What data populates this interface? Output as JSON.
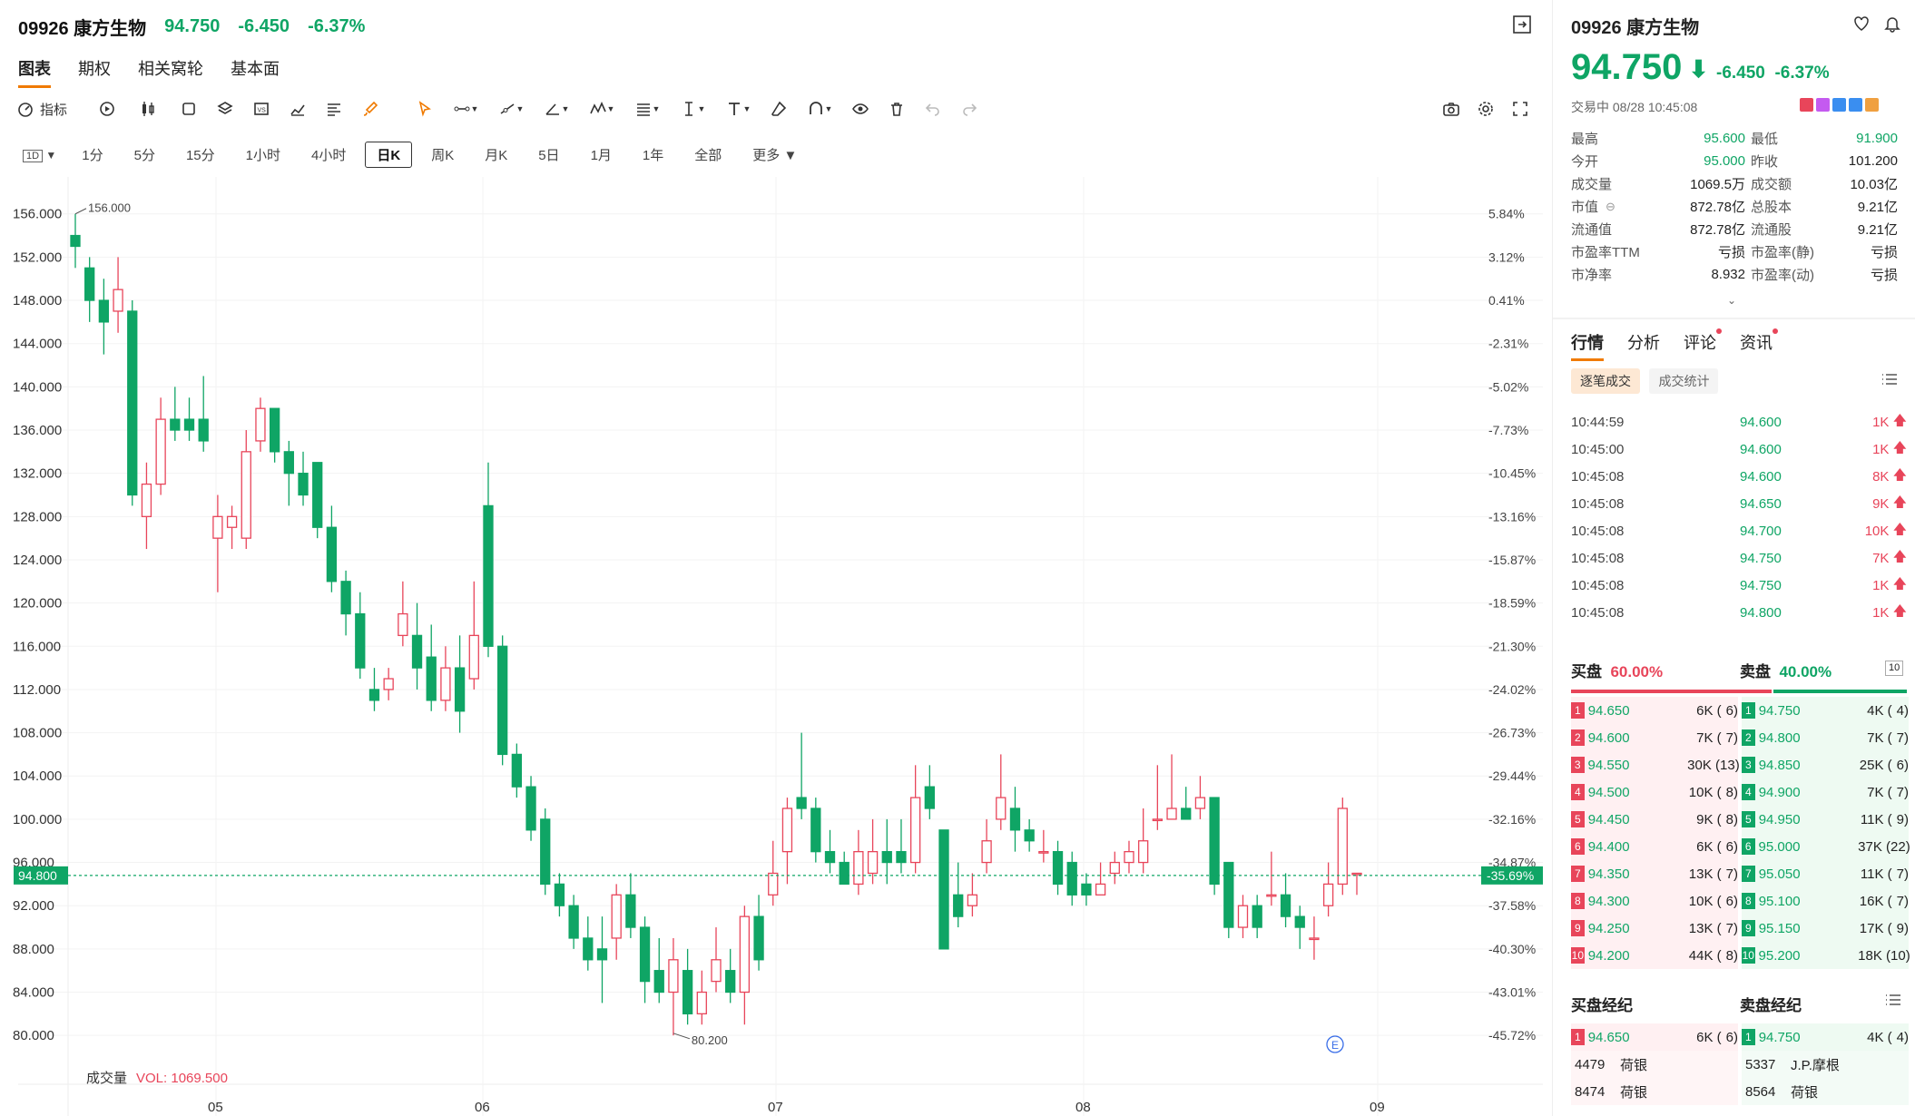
{
  "header": {
    "code": "09926 康方生物",
    "price": "94.750",
    "change": "-6.450",
    "pct": "-6.37%"
  },
  "tabs": [
    "图表",
    "期权",
    "相关窝轮",
    "基本面"
  ],
  "toolbar": {
    "indicator": "指标"
  },
  "intervals": [
    "1分",
    "5分",
    "15分",
    "1小时",
    "4小时",
    "日K",
    "周K",
    "月K",
    "5日",
    "1月",
    "1年",
    "全部",
    "更多"
  ],
  "interval_selector": "1D",
  "chart_data": {
    "type": "candlestick",
    "y_ticks": [
      "156.000",
      "152.000",
      "148.000",
      "144.000",
      "140.000",
      "136.000",
      "132.000",
      "128.000",
      "124.000",
      "120.000",
      "116.000",
      "112.000",
      "108.000",
      "104.000",
      "100.000",
      "96.000",
      "92.000",
      "88.000",
      "84.000",
      "80.000"
    ],
    "y_right_ticks": [
      "5.84%",
      "3.12%",
      "0.41%",
      "-2.31%",
      "-5.02%",
      "-7.73%",
      "-10.45%",
      "-13.16%",
      "-15.87%",
      "-18.59%",
      "-21.30%",
      "-24.02%",
      "-26.73%",
      "-29.44%",
      "-32.16%",
      "-34.87%",
      "-37.58%",
      "-40.30%",
      "-43.01%",
      "-45.72%"
    ],
    "x_ticks": [
      "05",
      "06",
      "07",
      "08",
      "09"
    ],
    "ylim": [
      78,
      159
    ],
    "high_label": "156.000",
    "low_label": "80.200",
    "last_price": "94.800",
    "last_pct": "-35.69%",
    "volume_label": "成交量",
    "volume_value": "VOL: 1069.500",
    "marker": "E",
    "candles": [
      [
        154,
        153,
        156,
        151
      ],
      [
        151,
        148,
        152,
        146
      ],
      [
        148,
        146,
        150,
        143
      ],
      [
        147,
        149,
        152,
        145
      ],
      [
        147,
        130,
        148,
        129
      ],
      [
        128,
        131,
        133,
        125
      ],
      [
        131,
        137,
        139,
        130
      ],
      [
        137,
        136,
        140,
        135
      ],
      [
        137,
        136,
        139,
        135
      ],
      [
        137,
        135,
        141,
        134
      ],
      [
        126,
        128,
        130,
        121
      ],
      [
        127,
        128,
        129,
        125
      ],
      [
        126,
        134,
        136,
        125
      ],
      [
        135,
        138,
        139,
        134
      ],
      [
        138,
        134,
        138,
        133
      ],
      [
        134,
        132,
        135,
        129
      ],
      [
        132,
        130,
        134,
        129
      ],
      [
        133,
        127,
        133,
        126
      ],
      [
        127,
        122,
        129,
        121
      ],
      [
        122,
        119,
        123,
        117
      ],
      [
        119,
        114,
        121,
        113
      ],
      [
        112,
        111,
        114,
        110
      ],
      [
        112,
        113,
        114,
        111
      ],
      [
        117,
        119,
        122,
        116
      ],
      [
        117,
        114,
        120,
        112
      ],
      [
        115,
        111,
        118,
        110
      ],
      [
        111,
        114,
        116,
        110
      ],
      [
        114,
        110,
        117,
        108
      ],
      [
        113,
        117,
        122,
        112
      ],
      [
        129,
        116,
        133,
        115
      ],
      [
        116,
        106,
        117,
        105
      ],
      [
        106,
        103,
        107,
        102
      ],
      [
        103,
        99,
        104,
        98
      ],
      [
        100,
        94,
        101,
        93
      ],
      [
        94,
        92,
        95,
        91
      ],
      [
        92,
        89,
        93,
        88
      ],
      [
        89,
        87,
        91,
        86
      ],
      [
        88,
        87,
        91,
        83
      ],
      [
        89,
        93,
        94,
        87
      ],
      [
        93,
        90,
        95,
        89
      ],
      [
        90,
        85,
        91,
        83
      ],
      [
        86,
        84,
        89,
        83
      ],
      [
        84,
        87,
        89,
        80
      ],
      [
        86,
        82,
        88,
        81
      ],
      [
        82,
        84,
        86,
        81
      ],
      [
        85,
        87,
        90,
        84
      ],
      [
        86,
        84,
        88,
        83
      ],
      [
        84,
        91,
        92,
        81
      ],
      [
        91,
        87,
        93,
        86
      ],
      [
        93,
        95,
        98,
        92
      ],
      [
        97,
        101,
        102,
        94
      ],
      [
        102,
        101,
        108,
        100
      ],
      [
        101,
        97,
        102,
        96
      ],
      [
        97,
        96,
        99,
        95
      ],
      [
        96,
        94,
        97,
        94
      ],
      [
        94,
        97,
        99,
        93
      ],
      [
        95,
        97,
        100,
        94
      ],
      [
        97,
        96,
        100,
        94
      ],
      [
        97,
        96,
        100,
        95
      ],
      [
        96,
        102,
        105,
        95
      ],
      [
        103,
        101,
        105,
        100
      ],
      [
        99,
        88,
        99,
        88
      ],
      [
        93,
        91,
        96,
        90
      ],
      [
        92,
        93,
        95,
        91
      ],
      [
        96,
        98,
        100,
        95
      ],
      [
        100,
        102,
        106,
        99
      ],
      [
        101,
        99,
        103,
        97
      ],
      [
        99,
        98,
        100,
        97
      ],
      [
        97,
        97,
        99,
        96
      ],
      [
        97,
        94,
        98,
        93
      ],
      [
        96,
        93,
        97,
        92
      ],
      [
        94,
        93,
        95,
        92
      ],
      [
        93,
        94,
        96,
        93
      ],
      [
        95,
        96,
        97,
        94
      ],
      [
        96,
        97,
        98,
        95
      ],
      [
        96,
        98,
        101,
        95
      ],
      [
        100,
        100,
        105,
        99
      ],
      [
        100,
        101,
        106,
        100
      ],
      [
        101,
        100,
        103,
        100
      ],
      [
        101,
        102,
        104,
        100
      ],
      [
        102,
        94,
        102,
        93
      ],
      [
        96,
        90,
        96,
        89
      ],
      [
        90,
        92,
        93,
        89
      ],
      [
        92,
        90,
        93,
        89
      ],
      [
        93,
        93,
        97,
        92
      ],
      [
        93,
        91,
        95,
        90
      ],
      [
        91,
        90,
        92,
        88
      ],
      [
        89,
        89,
        91,
        87
      ],
      [
        92,
        94,
        96,
        91
      ],
      [
        94,
        101,
        102,
        93
      ],
      [
        95,
        95,
        95,
        93
      ]
    ]
  },
  "right": {
    "title": "09926 康方生物",
    "price": "94.750",
    "change": "-6.450",
    "pct": "-6.37%",
    "status": "交易中 08/28 10:45:08",
    "stats": [
      [
        "最高",
        "95.600",
        "最低",
        "91.900"
      ],
      [
        "今开",
        "95.000",
        "昨收",
        "101.200"
      ],
      [
        "成交量",
        "1069.5万",
        "成交额",
        "10.03亿"
      ],
      [
        "市值",
        "872.78亿",
        "总股本",
        "9.21亿"
      ],
      [
        "流通值",
        "872.78亿",
        "流通股",
        "9.21亿"
      ],
      [
        "市盈率TTM",
        "亏损",
        "市盈率(静)",
        "亏损"
      ],
      [
        "市净率",
        "8.932",
        "市盈率(动)",
        "亏损"
      ]
    ],
    "subtabs": [
      "行情",
      "分析",
      "评论",
      "资讯"
    ],
    "pills": [
      "逐笔成交",
      "成交统计"
    ],
    "trades": [
      [
        "10:44:59",
        "94.600",
        "1K"
      ],
      [
        "10:45:00",
        "94.600",
        "1K"
      ],
      [
        "10:45:08",
        "94.600",
        "8K"
      ],
      [
        "10:45:08",
        "94.650",
        "9K"
      ],
      [
        "10:45:08",
        "94.700",
        "10K"
      ],
      [
        "10:45:08",
        "94.750",
        "7K"
      ],
      [
        "10:45:08",
        "94.750",
        "1K"
      ],
      [
        "10:45:08",
        "94.800",
        "1K"
      ]
    ],
    "buy_label": "买盘",
    "buy_pct": "60.00%",
    "sell_label": "卖盘",
    "sell_pct": "40.00%",
    "depth": "10",
    "bids": [
      [
        "1",
        "94.650",
        "6K (",
        "6)"
      ],
      [
        "2",
        "94.600",
        "7K (",
        "7)"
      ],
      [
        "3",
        "94.550",
        "30K (",
        "13)"
      ],
      [
        "4",
        "94.500",
        "10K (",
        "8)"
      ],
      [
        "5",
        "94.450",
        "9K (",
        "8)"
      ],
      [
        "6",
        "94.400",
        "6K (",
        "6)"
      ],
      [
        "7",
        "94.350",
        "13K (",
        "7)"
      ],
      [
        "8",
        "94.300",
        "10K (",
        "6)"
      ],
      [
        "9",
        "94.250",
        "13K (",
        "7)"
      ],
      [
        "10",
        "94.200",
        "44K (",
        "8)"
      ]
    ],
    "asks": [
      [
        "1",
        "94.750",
        "4K (",
        "4)"
      ],
      [
        "2",
        "94.800",
        "7K (",
        "7)"
      ],
      [
        "3",
        "94.850",
        "25K (",
        "6)"
      ],
      [
        "4",
        "94.900",
        "7K (",
        "7)"
      ],
      [
        "5",
        "94.950",
        "11K (",
        "9)"
      ],
      [
        "6",
        "95.000",
        "37K (",
        "22)"
      ],
      [
        "7",
        "95.050",
        "11K (",
        "7)"
      ],
      [
        "8",
        "95.100",
        "16K (",
        "7)"
      ],
      [
        "9",
        "95.150",
        "17K (",
        "9)"
      ],
      [
        "10",
        "95.200",
        "18K (",
        "10)"
      ]
    ],
    "broker_buy_label": "买盘经纪",
    "broker_sell_label": "卖盘经纪",
    "broker_buy": {
      "n": "1",
      "price": "94.650",
      "vol": "6K (",
      "cnt": "6)",
      "rows": [
        [
          "4479",
          "荷银"
        ],
        [
          "8474",
          "荷银"
        ]
      ]
    },
    "broker_sell": {
      "n": "1",
      "price": "94.750",
      "vol": "4K (",
      "cnt": "4)",
      "rows": [
        [
          "5337",
          "J.P.摩根"
        ],
        [
          "8564",
          "荷银"
        ]
      ]
    }
  }
}
